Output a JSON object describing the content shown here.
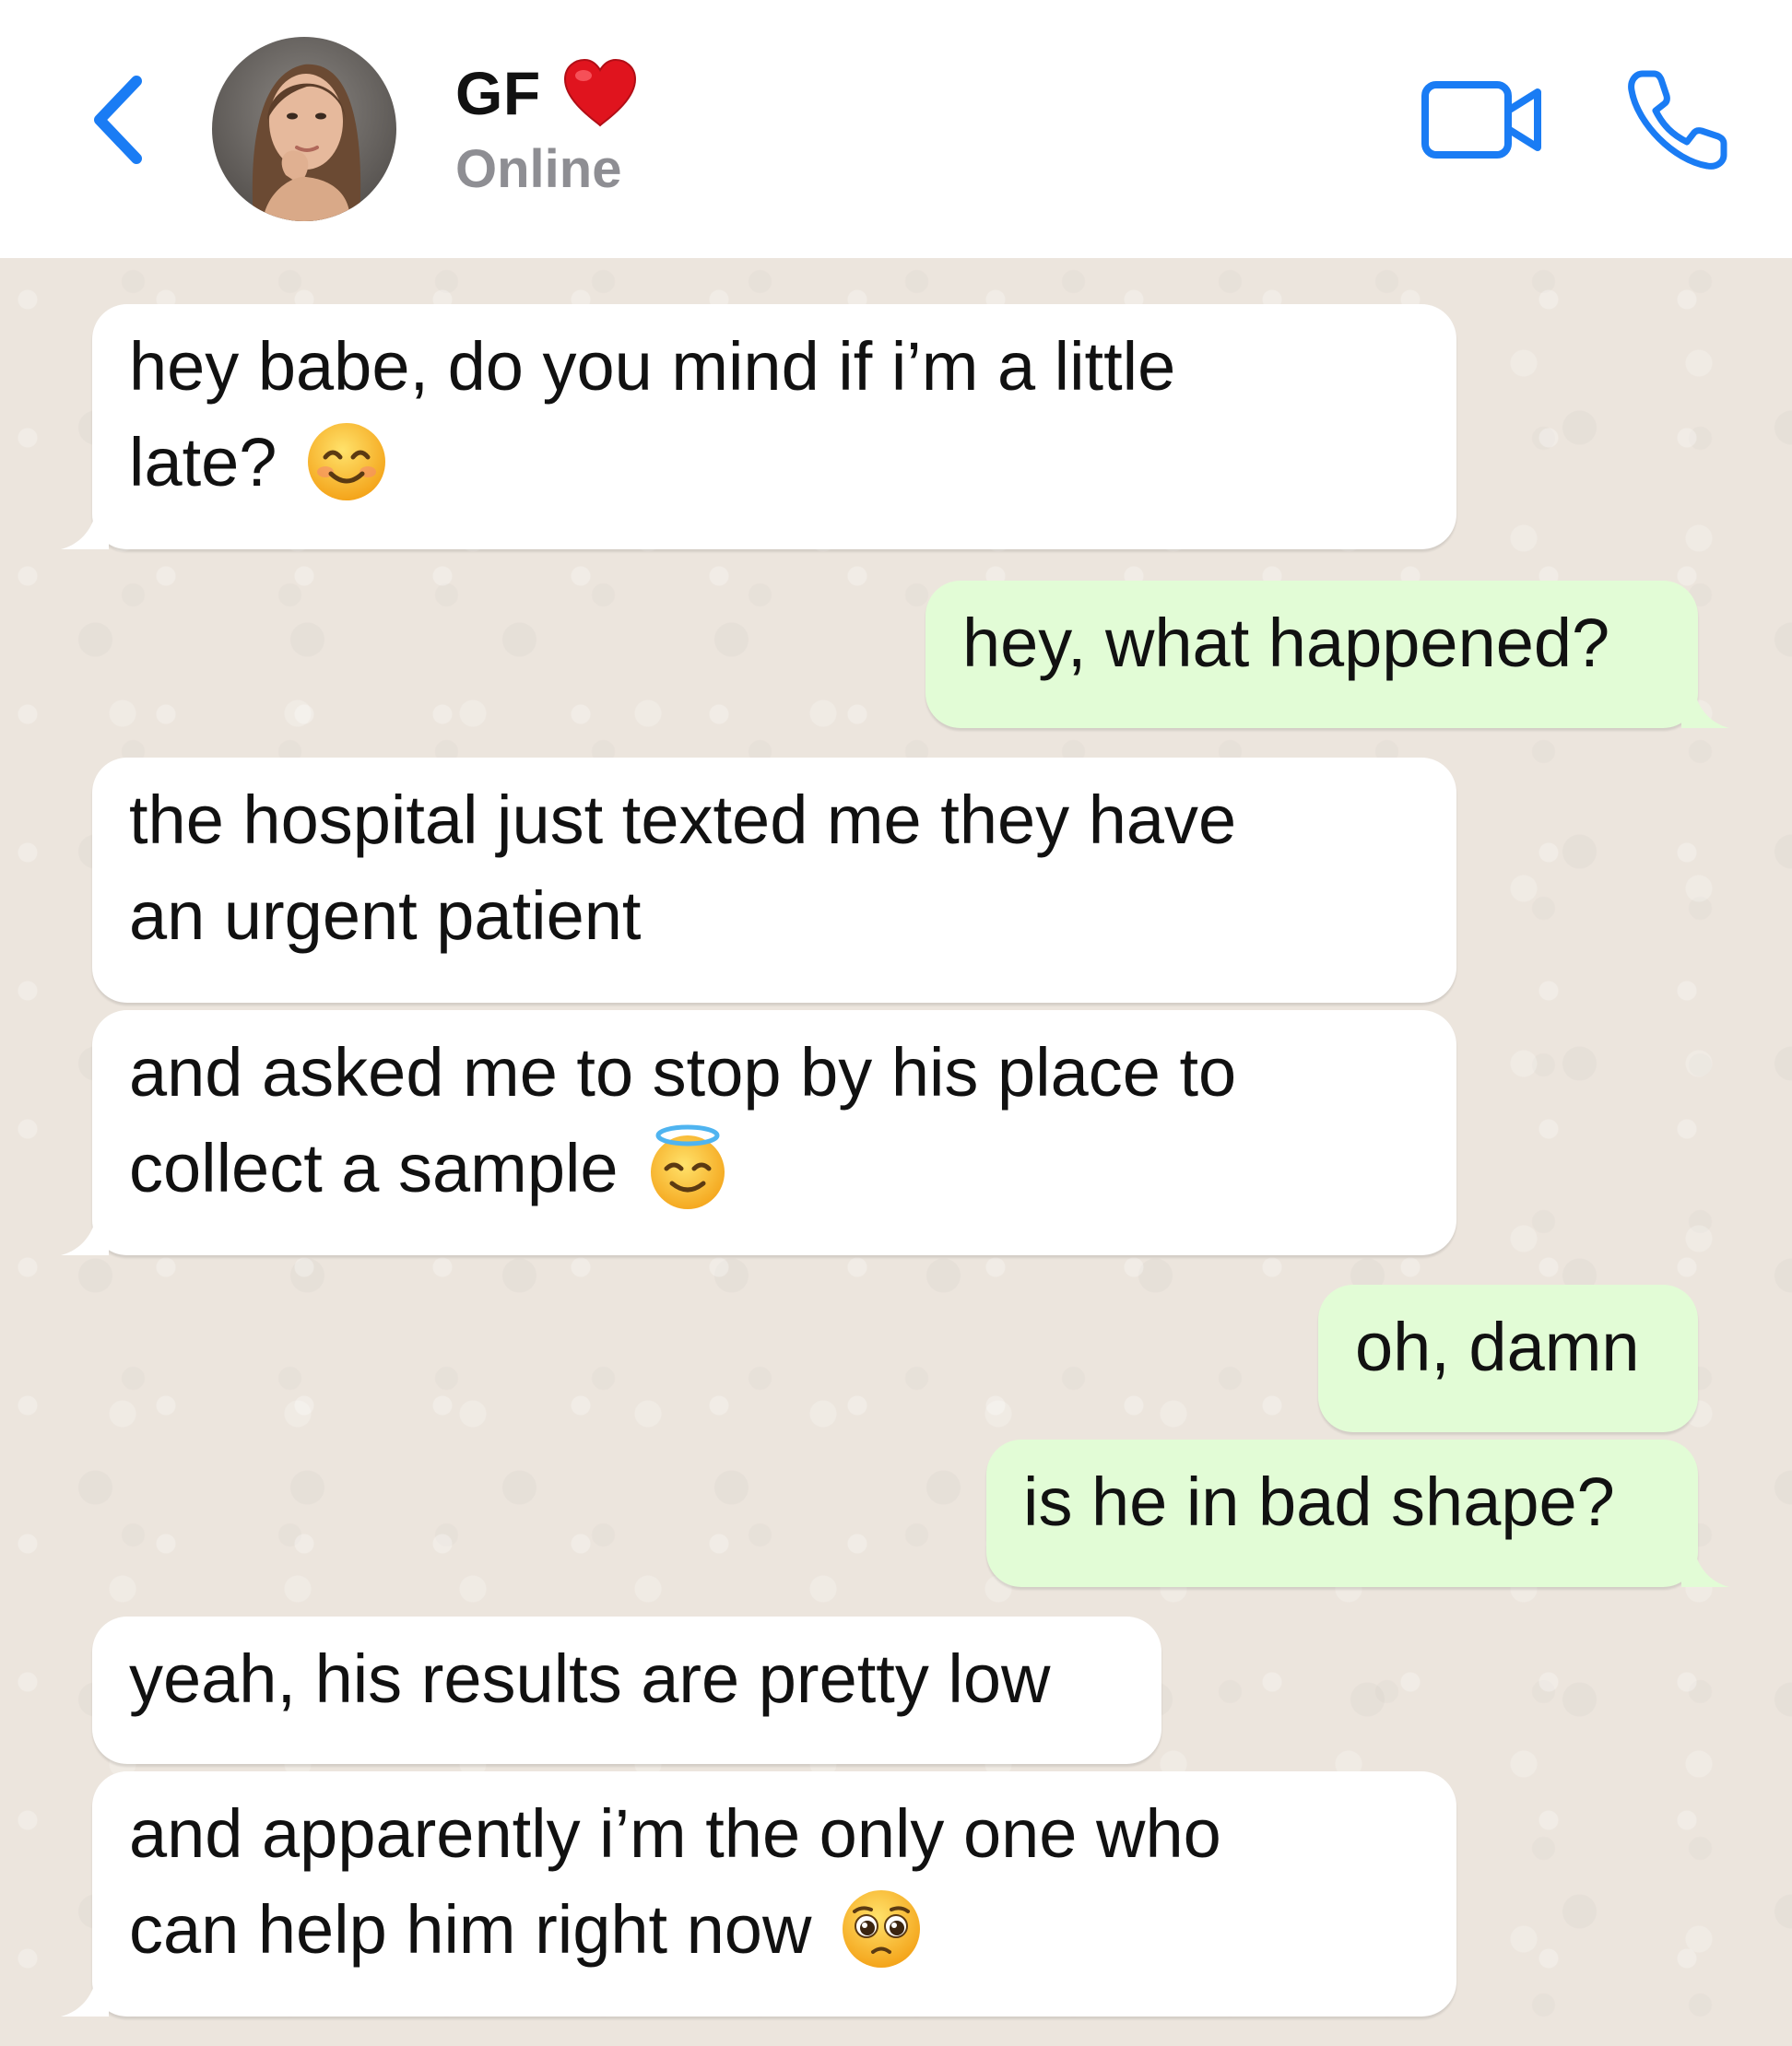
{
  "header": {
    "back_icon": "chevron-left-icon",
    "contact_name": "GF",
    "name_emoji": "red-heart",
    "status": "Online",
    "video_icon": "video-camera-icon",
    "call_icon": "phone-icon",
    "accent_color": "#1a7cf4"
  },
  "messages": [
    {
      "direction": "incoming",
      "text": "hey babe, do you mind if i’m a little late?",
      "line1": "hey babe, do you mind if i’m a little",
      "line2": "late?",
      "emoji": "smiling-face-with-smiling-eyes"
    },
    {
      "direction": "outgoing",
      "text": "hey, what happened?"
    },
    {
      "direction": "incoming",
      "text": "the hospital just texted me they have an urgent patient",
      "line1": "the hospital just texted me they have",
      "line2": "an urgent patient"
    },
    {
      "direction": "incoming",
      "text": "and asked me to stop by his place to collect a sample",
      "line1": "and asked me to stop by his place to",
      "line2": "collect a sample",
      "emoji": "smiling-face-with-halo"
    },
    {
      "direction": "outgoing",
      "text": "oh, damn"
    },
    {
      "direction": "outgoing",
      "text": "is he in bad shape?"
    },
    {
      "direction": "incoming",
      "text": "yeah, his results are pretty low"
    },
    {
      "direction": "incoming",
      "text": "and apparently i’m the only one who can help him right now",
      "line1": "and apparently i’m the only one who",
      "line2": "can help him right now",
      "emoji": "pleading-face"
    }
  ],
  "colors": {
    "incoming_bubble": "#ffffff",
    "outgoing_bubble": "#e2fcd6",
    "chat_background": "#ece5dd",
    "status_gray": "#8e8e93"
  }
}
